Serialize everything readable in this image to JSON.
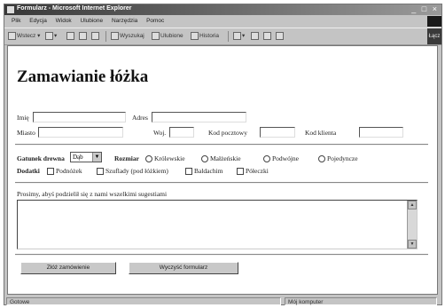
{
  "window": {
    "title": "Formularz - Microsoft Internet Explorer",
    "controls": "_ □ ×"
  },
  "menubar": {
    "items": [
      "Plik",
      "Edycja",
      "Widok",
      "Ulubione",
      "Narzędzia",
      "Pomoc"
    ]
  },
  "toolbar": {
    "back": "Wstecz",
    "search": "Wyszukaj",
    "favorites": "Ulubione",
    "history": "Historia",
    "end_label": "Łącz"
  },
  "form": {
    "title": "Zamawianie łóżka",
    "labels": {
      "name": "Imię",
      "address": "Adres",
      "city": "Miasto",
      "province": "Woj.",
      "postal_code": "Kod pocztowy",
      "client_code": "Kod klienta"
    },
    "wood_label": "Gatunek drewna",
    "wood_selected": "Dąb",
    "size_label": "Rozmiar",
    "sizes": [
      "Królewskie",
      "Małżeńskie",
      "Podwójne",
      "Pojedyncze"
    ],
    "extras_label": "Dodatki",
    "extras": [
      "Podnóżek",
      "Szuflady (pod łóżkiem)",
      "Baldachim",
      "Półeczki"
    ],
    "comments_label": "Prosimy, abyś podzielił się z nami wszelkimi sugestiami",
    "submit_label": "Złóż zamówienie",
    "reset_label": "Wyczyść formularz"
  },
  "statusbar": {
    "left": "Gotowe",
    "right": "Mój komputer"
  }
}
